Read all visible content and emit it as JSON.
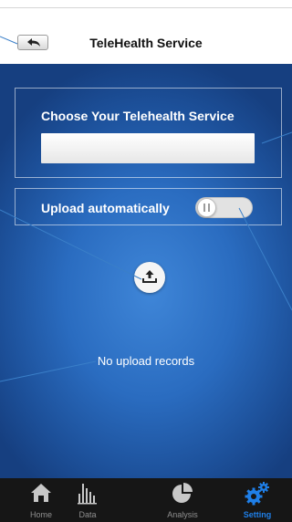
{
  "header": {
    "title": "TeleHealth Service",
    "back_icon": "back-arrow-icon"
  },
  "service": {
    "title": "Choose Your Telehealth Service",
    "selected_value": ""
  },
  "upload": {
    "label": "Upload automatically",
    "toggle_state": "off",
    "button_icon": "upload-icon"
  },
  "records": {
    "empty_message": "No upload records"
  },
  "tabbar": {
    "items": [
      {
        "label": "Home",
        "icon": "home-icon"
      },
      {
        "label": "Data",
        "icon": "bar-chart-icon"
      },
      {
        "label": "Analysis",
        "icon": "pie-chart-icon"
      },
      {
        "label": "Setting",
        "icon": "gears-icon"
      }
    ],
    "active_index": 3
  },
  "colors": {
    "accent": "#1f7fe8",
    "background_blue": "#2a6cc0",
    "tabbar_bg": "#161616"
  }
}
